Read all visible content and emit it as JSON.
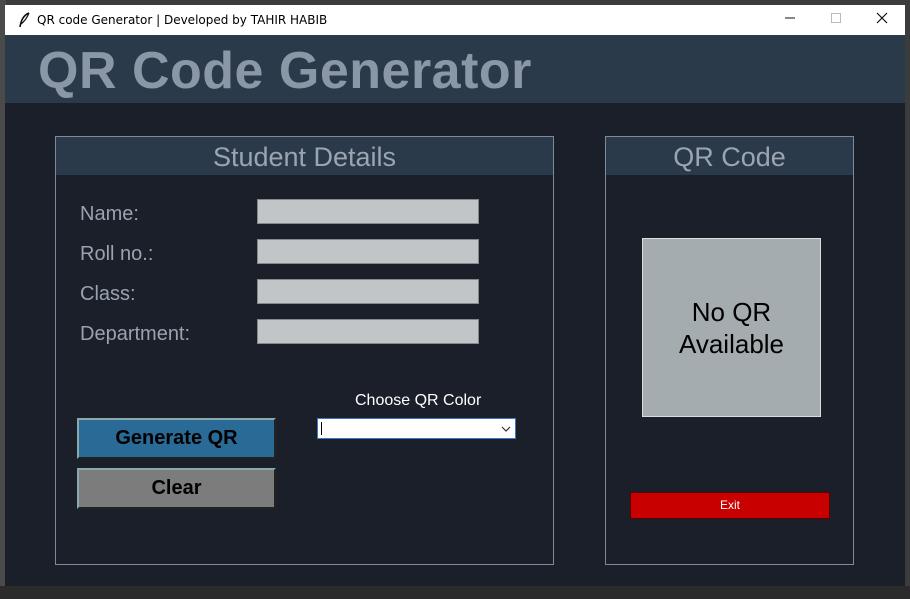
{
  "window": {
    "title": "QR code Generator | Developed by TAHIR HABIB",
    "controls": {
      "minimize_icon": "minimize-icon",
      "maximize_icon": "maximize-icon",
      "close_icon": "close-icon"
    }
  },
  "header": {
    "title": "QR Code Generator"
  },
  "student_panel": {
    "title": "Student Details",
    "fields": [
      {
        "label": "Name:",
        "value": ""
      },
      {
        "label": "Roll no.:",
        "value": ""
      },
      {
        "label": "Class:",
        "value": ""
      },
      {
        "label": "Department:",
        "value": ""
      }
    ],
    "color_label": "Choose QR Color",
    "color_value": "",
    "generate_label": "Generate QR",
    "clear_label": "Clear"
  },
  "qr_panel": {
    "title": "QR Code",
    "placeholder": "No QR\n Available",
    "exit_label": "Exit"
  },
  "colors": {
    "background": "#1b1f29",
    "header": "#2b3a4b",
    "generate_button": "#2a6a96",
    "clear_button": "#7c7c7c",
    "exit_button": "#c80000",
    "qr_box": "#a4acaf"
  }
}
